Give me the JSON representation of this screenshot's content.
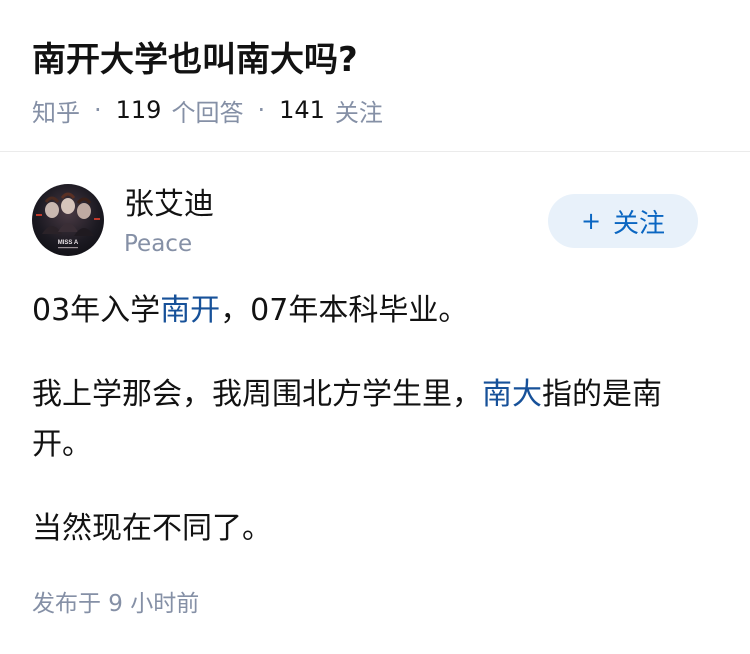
{
  "question": {
    "title": "南开大学也叫南大吗?",
    "source": "知乎",
    "answer_count": "119",
    "answer_label": "个回答",
    "follower_count": "141",
    "follower_label": "关注",
    "separator": "·"
  },
  "author": {
    "name": "张艾迪",
    "bio": "Peace",
    "avatar_caption": "MISS A",
    "avatar_icon": "avatar-photo"
  },
  "follow_button": {
    "plus": "+",
    "label": "关注"
  },
  "answer": {
    "p1_a": "03年入学",
    "p1_link": "南开",
    "p1_b": "，07年本科毕业。",
    "p2_a": "我上学那会，我周围北方学生里，",
    "p2_link": "南大",
    "p2_b": "指的是南开。",
    "p3": "当然现在不同了。",
    "published": "发布于 9 小时前"
  },
  "colors": {
    "text": "#121212",
    "meta": "#8590a6",
    "link": "#175199",
    "button_bg": "#e8f1fa",
    "button_text": "#0a66c2"
  }
}
